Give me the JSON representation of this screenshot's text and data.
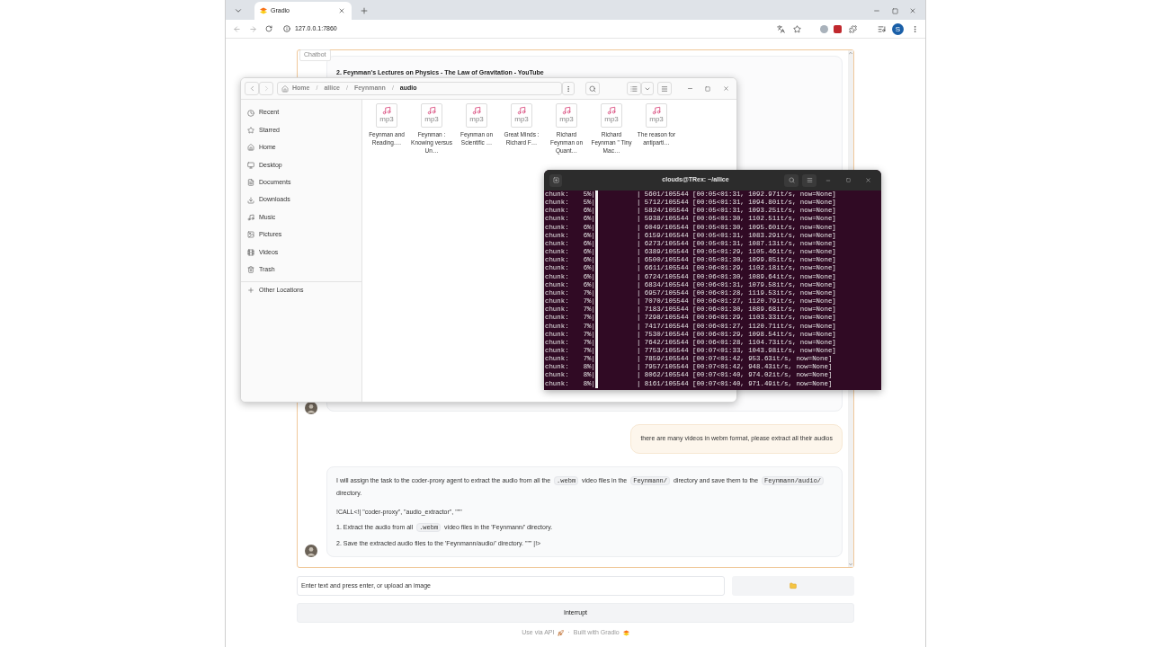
{
  "browser": {
    "tab_title": "Gradio",
    "url": "127.0.0.1:7860",
    "profile_initial": "S"
  },
  "gradio": {
    "chatbot_label": "Chatbot",
    "first_message_heading": "2. Feynman's Lectures on Physics - The Law of Gravitation - YouTube",
    "user_message": "there are many videos in webm format, please extract all their audios",
    "bot_paragraphs": [
      [
        {
          "kind": "text",
          "text": "I will assign the task to the coder-proxy agent to extract the audio from all the "
        },
        {
          "kind": "code",
          "text": ".webm"
        },
        {
          "kind": "text",
          "text": " video files in the "
        },
        {
          "kind": "code",
          "text": "Feynmann/"
        },
        {
          "kind": "text",
          "text": " directory and save them to the "
        },
        {
          "kind": "code",
          "text": "Feynmann/audio/"
        },
        {
          "kind": "text",
          "text": " directory."
        }
      ],
      [
        {
          "kind": "text",
          "text": "!CALL<!| \"coder-proxy\", \"audio_extractor\", \"\"\""
        }
      ],
      [
        {
          "kind": "text",
          "text": "1. Extract the audio from all "
        },
        {
          "kind": "code",
          "text": ".webm"
        },
        {
          "kind": "text",
          "text": " video files in the 'Feynmann/' directory."
        }
      ],
      [
        {
          "kind": "text",
          "text": "2. Save the extracted audio files to the 'Feynmann/audio/' directory. \"\"\" |!>"
        }
      ]
    ],
    "input_placeholder": "Enter text and press enter, or upload an image",
    "interrupt_button": "Interrupt",
    "footer_api": "Use via API",
    "footer_separator": "·",
    "footer_built": "Built with Gradio"
  },
  "files_window": {
    "path": [
      "Home",
      "allice",
      "Feynmann",
      "audio"
    ],
    "path_separator": "/",
    "sidebar": [
      {
        "label": "Recent"
      },
      {
        "label": "Starred"
      },
      {
        "label": "Home"
      },
      {
        "label": "Desktop"
      },
      {
        "label": "Documents"
      },
      {
        "label": "Downloads"
      },
      {
        "label": "Music"
      },
      {
        "label": "Pictures"
      },
      {
        "label": "Videos"
      },
      {
        "label": "Trash"
      }
    ],
    "other_locations": "Other Locations",
    "files": [
      {
        "name": "Feynman and Reading.…",
        "type_label": "mp3"
      },
      {
        "name": "Feynman : Knowing versus Un…",
        "type_label": "mp3"
      },
      {
        "name": "Feynman on Scientific …",
        "type_label": "mp3"
      },
      {
        "name": "Great Minds : Richard F…",
        "type_label": "mp3"
      },
      {
        "name": "Richard Feynman on Quant…",
        "type_label": "mp3"
      },
      {
        "name": "Richard Feynman \" Tiny Mac…",
        "type_label": "mp3"
      },
      {
        "name": "The reason for antiparti…",
        "type_label": "mp3"
      }
    ]
  },
  "terminal": {
    "title": "clouds@TRex: ~/allice",
    "lines": [
      {
        "label": "chunk:",
        "percent": "5%|",
        "stats": "| 5601/105544 [00:05<01:31, 1092.97it/s, now=None]"
      },
      {
        "label": "chunk:",
        "percent": "5%|",
        "stats": "| 5712/105544 [00:05<01:31, 1094.80it/s, now=None]"
      },
      {
        "label": "chunk:",
        "percent": "6%|",
        "stats": "| 5824/105544 [00:05<01:31, 1093.25it/s, now=None]"
      },
      {
        "label": "chunk:",
        "percent": "6%|",
        "stats": "| 5938/105544 [00:05<01:30, 1102.51it/s, now=None]"
      },
      {
        "label": "chunk:",
        "percent": "6%|",
        "stats": "| 6049/105544 [00:05<01:30, 1095.60it/s, now=None]"
      },
      {
        "label": "chunk:",
        "percent": "6%|",
        "stats": "| 6159/105544 [00:05<01:31, 1083.29it/s, now=None]"
      },
      {
        "label": "chunk:",
        "percent": "6%|",
        "stats": "| 6273/105544 [00:05<01:31, 1087.13it/s, now=None]"
      },
      {
        "label": "chunk:",
        "percent": "6%|",
        "stats": "| 6389/105544 [00:05<01:29, 1105.46it/s, now=None]"
      },
      {
        "label": "chunk:",
        "percent": "6%|",
        "stats": "| 6500/105544 [00:05<01:30, 1099.85it/s, now=None]"
      },
      {
        "label": "chunk:",
        "percent": "6%|",
        "stats": "| 6611/105544 [00:06<01:29, 1102.18it/s, now=None]"
      },
      {
        "label": "chunk:",
        "percent": "6%|",
        "stats": "| 6724/105544 [00:06<01:30, 1089.64it/s, now=None]"
      },
      {
        "label": "chunk:",
        "percent": "6%|",
        "stats": "| 6834/105544 [00:06<01:31, 1079.58it/s, now=None]"
      },
      {
        "label": "chunk:",
        "percent": "7%|",
        "stats": "| 6957/105544 [00:06<01:28, 1119.53it/s, now=None]"
      },
      {
        "label": "chunk:",
        "percent": "7%|",
        "stats": "| 7070/105544 [00:06<01:27, 1120.79it/s, now=None]"
      },
      {
        "label": "chunk:",
        "percent": "7%|",
        "stats": "| 7183/105544 [00:06<01:30, 1089.68it/s, now=None]"
      },
      {
        "label": "chunk:",
        "percent": "7%|",
        "stats": "| 7298/105544 [00:06<01:29, 1103.33it/s, now=None]"
      },
      {
        "label": "chunk:",
        "percent": "7%|",
        "stats": "| 7417/105544 [00:06<01:27, 1120.71it/s, now=None]"
      },
      {
        "label": "chunk:",
        "percent": "7%|",
        "stats": "| 7530/105544 [00:06<01:29, 1098.54it/s, now=None]"
      },
      {
        "label": "chunk:",
        "percent": "7%|",
        "stats": "| 7642/105544 [00:06<01:28, 1104.73it/s, now=None]"
      },
      {
        "label": "chunk:",
        "percent": "7%|",
        "stats": "| 7753/105544 [00:07<01:33, 1043.98it/s, now=None]"
      },
      {
        "label": "chunk:",
        "percent": "7%|",
        "stats": "| 7859/105544 [00:07<01:42, 953.63it/s, now=None]"
      },
      {
        "label": "chunk:",
        "percent": "8%|",
        "stats": "| 7957/105544 [00:07<01:42, 948.43it/s, now=None]"
      },
      {
        "label": "chunk:",
        "percent": "8%|",
        "stats": "| 8062/105544 [00:07<01:40, 974.02it/s, now=None]"
      },
      {
        "label": "chunk:",
        "percent": "8%|",
        "stats": "| 8161/105544 [00:07<01:40, 971.49it/s, now=None]"
      }
    ]
  }
}
